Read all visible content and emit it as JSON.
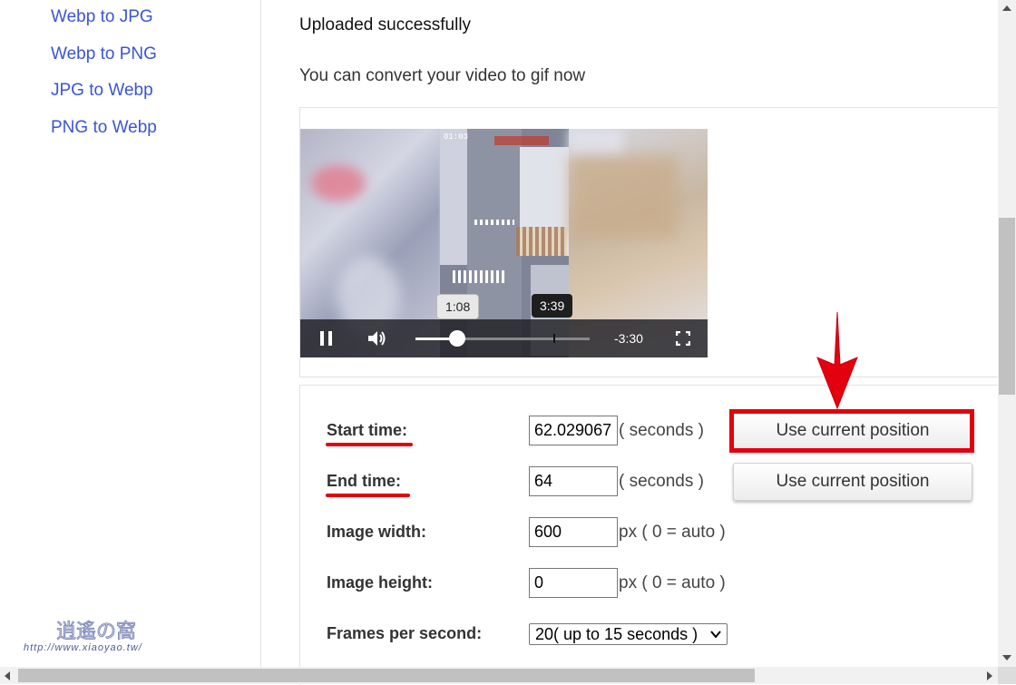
{
  "sidebar": {
    "links": [
      "Webp to JPG",
      "Webp to PNG",
      "JPG to Webp",
      "PNG to Webp"
    ]
  },
  "main": {
    "status": "Uploaded successfully",
    "instruction": "You can convert your video to gif now"
  },
  "player": {
    "hover_time": "1:08",
    "marker_time": "3:39",
    "remaining": "-3:30",
    "progress": 0.24,
    "marker_position": 0.79,
    "pause_icon": "pause-icon",
    "volume_icon": "volume-icon",
    "fullscreen_icon": "fullscreen-icon",
    "game_hud_timer": "01:03"
  },
  "form": {
    "start": {
      "label": "Start time:",
      "value": "62.029067",
      "unit": "( seconds )",
      "button": "Use current position"
    },
    "end": {
      "label": "End time:",
      "value": "64",
      "unit": "( seconds )",
      "button": "Use current position"
    },
    "width": {
      "label": "Image width:",
      "value": "600",
      "unit": "px ( 0 = auto )"
    },
    "height": {
      "label": "Image height:",
      "value": "0",
      "unit": "px ( 0 = auto )"
    },
    "fps": {
      "label": "Frames per second:",
      "selected": "20( up to 15 seconds )"
    }
  },
  "annotation": {
    "color": "#e3000f"
  },
  "watermark": {
    "text": "http://www.xiaoyao.tw/"
  }
}
